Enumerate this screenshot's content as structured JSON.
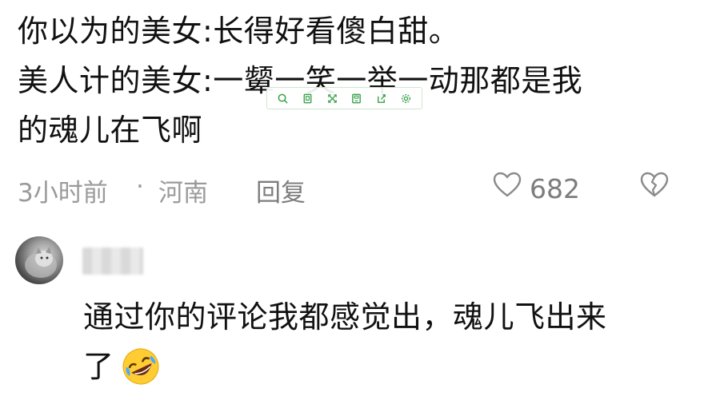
{
  "comment": {
    "line1": "你以为的美女:长得好看傻白甜。",
    "line2": "美人计的美女:一颦一笑一举一动那都是我",
    "line3": "的魂儿在飞啊"
  },
  "toolbar": {
    "icons": [
      "search-icon",
      "crop-icon",
      "expand-icon",
      "save-icon",
      "share-icon",
      "settings-icon"
    ],
    "accent": "#3aa14a"
  },
  "meta": {
    "time": "3小时前",
    "separator": "·",
    "location": "河南",
    "reply_label": "回复",
    "like_count": "682",
    "like_icon": "heart-outline-icon",
    "dislike_icon": "broken-heart-icon",
    "color": "#9a9a9a"
  },
  "reply": {
    "avatar": "cat-avatar",
    "line1": "通过你的评论我都感觉出，魂儿飞出来",
    "line2": "了",
    "emoji": "rolling-on-floor-laughing-emoji"
  }
}
